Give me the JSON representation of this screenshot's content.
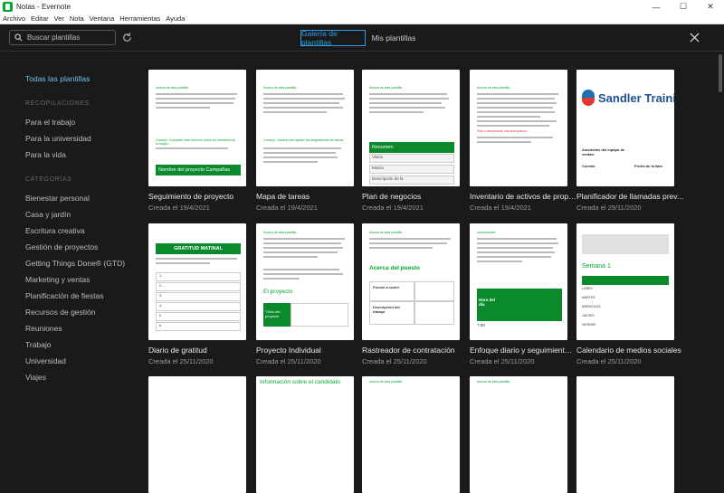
{
  "window": {
    "title": "Notas - Evernote",
    "minimize": "—",
    "maximize": "☐",
    "close": "✕"
  },
  "menu": [
    "Archivo",
    "Editar",
    "Ver",
    "Nota",
    "Ventana",
    "Herramientas",
    "Ayuda"
  ],
  "search": {
    "placeholder": "Buscar plantillas"
  },
  "tabs": {
    "gallery": "Galería de plantillas",
    "mine": "Mis plantillas"
  },
  "sidebar": {
    "all": "Todas las plantillas",
    "recs_heading": "RECOPILACIONES",
    "recs": [
      "Para el trabajo",
      "Para la universidad",
      "Para la vida"
    ],
    "cats_heading": "CATEGORÍAS",
    "cats": [
      "Bienestar personal",
      "Casa y jardín",
      "Escritura creativa",
      "Gestión de proyectos",
      "Getting Things Done® (GTD)",
      "Marketing y ventas",
      "Planificación de fiestas",
      "Recursos de gestión",
      "Reuniones",
      "Trabajo",
      "Universidad",
      "Viajes"
    ]
  },
  "templates": [
    {
      "name": "Seguimiento de proyecto",
      "date": "Creada el 19/4/2021",
      "thumb_head": "Acerca de esta plantilla",
      "thumb_green": "Nombre del proyecto Campañas",
      "thumb_sub": "Consejo: Comparte esta nota con todos los miembros de tu equipo"
    },
    {
      "name": "Mapa de tareas",
      "date": "Creada el 19/4/2021",
      "thumb_head": "Acerca de esta plantilla",
      "thumb_green": "",
      "thumb_sub": "Consejo: Cambia con rapidez las asignaciones de tareas"
    },
    {
      "name": "Plan de negocios",
      "date": "Creada el 19/4/2021",
      "thumb_head": "Acerca de esta plantilla",
      "thumb_green": "Resumen",
      "thumb_rows": [
        "Visión",
        "Misión",
        "Descripción de la"
      ]
    },
    {
      "name": "Inventario de activos de propi...",
      "date": "Creada el 19/4/2021",
      "thumb_head": "Acerca de esta plantilla",
      "thumb_green": "",
      "thumb_sub": "Sólo si encuentras una anticipación"
    },
    {
      "name": "Planificador de llamadas prev...",
      "date": "Creada el 29/11/2020",
      "thumb_logo": "Sandler Traini",
      "thumb_rows": [
        "Asistentes del equipo de ventas:",
        "Cuenta:",
        "Fecha de la llam"
      ]
    },
    {
      "name": "Diario de gratitud",
      "date": "Creada el 25/11/2020",
      "thumb_green": "GRATITUD MATINAL",
      "thumb_rows": [
        "1.",
        "2.",
        "3.",
        "4.",
        "5.",
        "6."
      ]
    },
    {
      "name": "Proyecto Individual",
      "date": "Creada el 25/11/2020",
      "thumb_head": "Acerca de esta plantilla",
      "thumb_green": "El proyecto",
      "thumb_rows": [
        "Título del proyecto"
      ]
    },
    {
      "name": "Rastreador de contratación",
      "date": "Creada el 25/11/2020",
      "thumb_head": "Acerca de esta plantilla",
      "thumb_green": "Acerca del puesto",
      "thumb_rows": [
        "Puesto a cubrir",
        "Descripción del trabajo"
      ]
    },
    {
      "name": "Enfoque diario y seguimiento ...",
      "date": "Creada el 25/11/2020",
      "thumb_head": "Instrucciones",
      "thumb_green": "Hora del día",
      "thumb_rows": [
        "7:00"
      ]
    },
    {
      "name": "Calendario de medios sociales",
      "date": "Creada el 25/11/2020",
      "thumb_green": "Semana 1",
      "thumb_rows": [
        "LUNES",
        "MARTES",
        "MIÉRCOLES",
        "JUEVES",
        "VIERNES"
      ]
    }
  ],
  "third_row": [
    {
      "thumb_head": ""
    },
    {
      "thumb_green": "Información sobre el candidato"
    },
    {
      "thumb_head": "Acerca de esta plantilla"
    },
    {
      "thumb_head": "Acerca de esta plantilla"
    },
    {
      "thumb_head": ""
    }
  ]
}
